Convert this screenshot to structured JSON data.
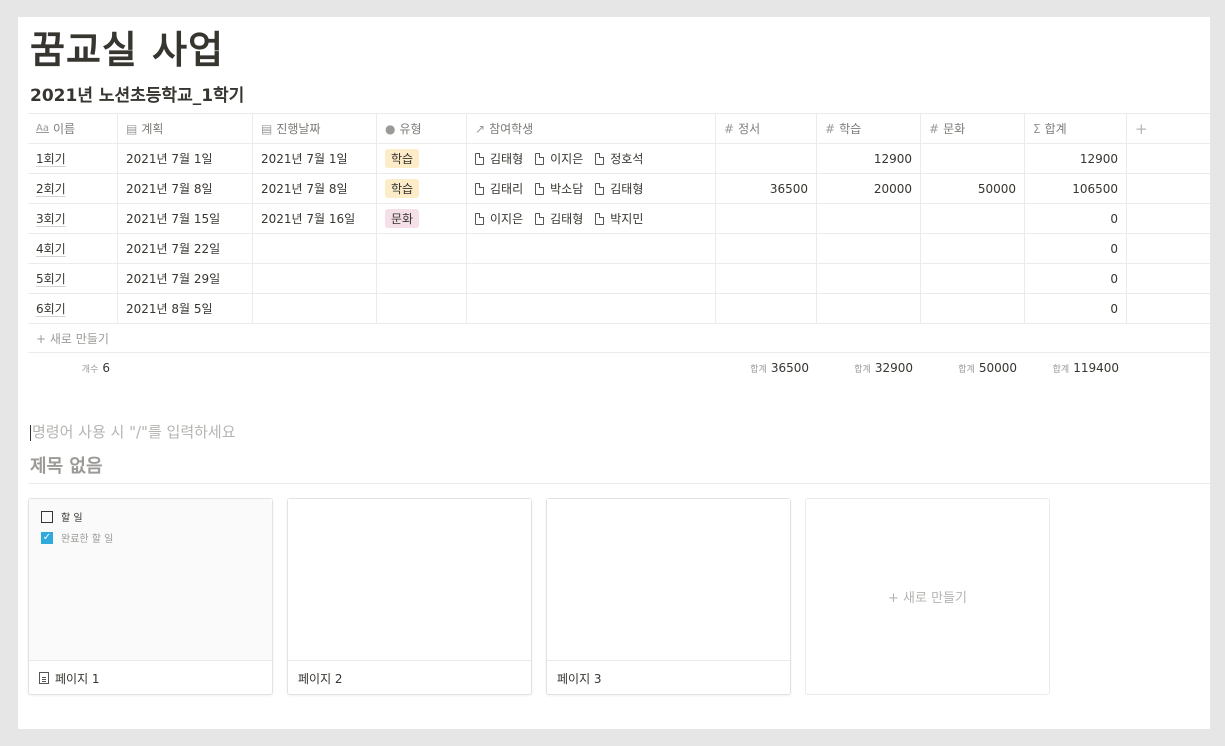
{
  "page": {
    "title": "꿈교실 사업",
    "subtitle": "2021년 노션초등학교_1학기"
  },
  "table": {
    "headers": [
      {
        "icon": "Aa",
        "label": "이름"
      },
      {
        "icon": "▤",
        "label": "계획"
      },
      {
        "icon": "▤",
        "label": "진행날짜"
      },
      {
        "icon": "●",
        "label": "유형"
      },
      {
        "icon": "↗",
        "label": "참여학생"
      },
      {
        "icon": "#",
        "label": "정서"
      },
      {
        "icon": "#",
        "label": "학습"
      },
      {
        "icon": "#",
        "label": "문화"
      },
      {
        "icon": "Σ",
        "label": "합계"
      },
      {
        "icon": "",
        "label": "+"
      }
    ],
    "rows": [
      {
        "name": "1회기",
        "plan": "2021년 7월 1일",
        "date": "2021년 7월 1일",
        "type": "학습",
        "students": [
          "김태형",
          "이지은",
          "정호석"
        ],
        "emotion": "",
        "study": "12900",
        "culture": "",
        "total": "12900"
      },
      {
        "name": "2회기",
        "plan": "2021년 7월 8일",
        "date": "2021년 7월 8일",
        "type": "학습",
        "students": [
          "김태리",
          "박소담",
          "김태형"
        ],
        "emotion": "36500",
        "study": "20000",
        "culture": "50000",
        "total": "106500"
      },
      {
        "name": "3회기",
        "plan": "2021년 7월 15일",
        "date": "2021년 7월 16일",
        "type": "문화",
        "students": [
          "이지은",
          "김태형",
          "박지민"
        ],
        "emotion": "",
        "study": "",
        "culture": "",
        "total": "0"
      },
      {
        "name": "4회기",
        "plan": "2021년 7월 22일",
        "date": "",
        "type": "",
        "students": [],
        "emotion": "",
        "study": "",
        "culture": "",
        "total": "0"
      },
      {
        "name": "5회기",
        "plan": "2021년 7월 29일",
        "date": "",
        "type": "",
        "students": [],
        "emotion": "",
        "study": "",
        "culture": "",
        "total": "0"
      },
      {
        "name": "6회기",
        "plan": "2021년 8월 5일",
        "date": "",
        "type": "",
        "students": [],
        "emotion": "",
        "study": "",
        "culture": "",
        "total": "0"
      }
    ],
    "new_row_label": "+ 새로 만들기",
    "calc": {
      "count_label": "개수",
      "count_value": "6",
      "sum_label": "합계",
      "emotion_sum": "36500",
      "study_sum": "32900",
      "culture_sum": "50000",
      "total_sum": "119400"
    }
  },
  "editor": {
    "placeholder": "명령어 사용 시 \"/\"를 입력하세요"
  },
  "board": {
    "title": "제목 없음",
    "cards": [
      {
        "label": "페이지 1",
        "todo": "할 일",
        "done": "완료한 할 일"
      },
      {
        "label": "페이지 2"
      },
      {
        "label": "페이지 3"
      }
    ],
    "new_label": "+ 새로 만들기"
  },
  "colors": {
    "tag_study": "#fdecc8",
    "tag_culture": "#f5e0e9",
    "checkbox": "#2eaadc"
  }
}
